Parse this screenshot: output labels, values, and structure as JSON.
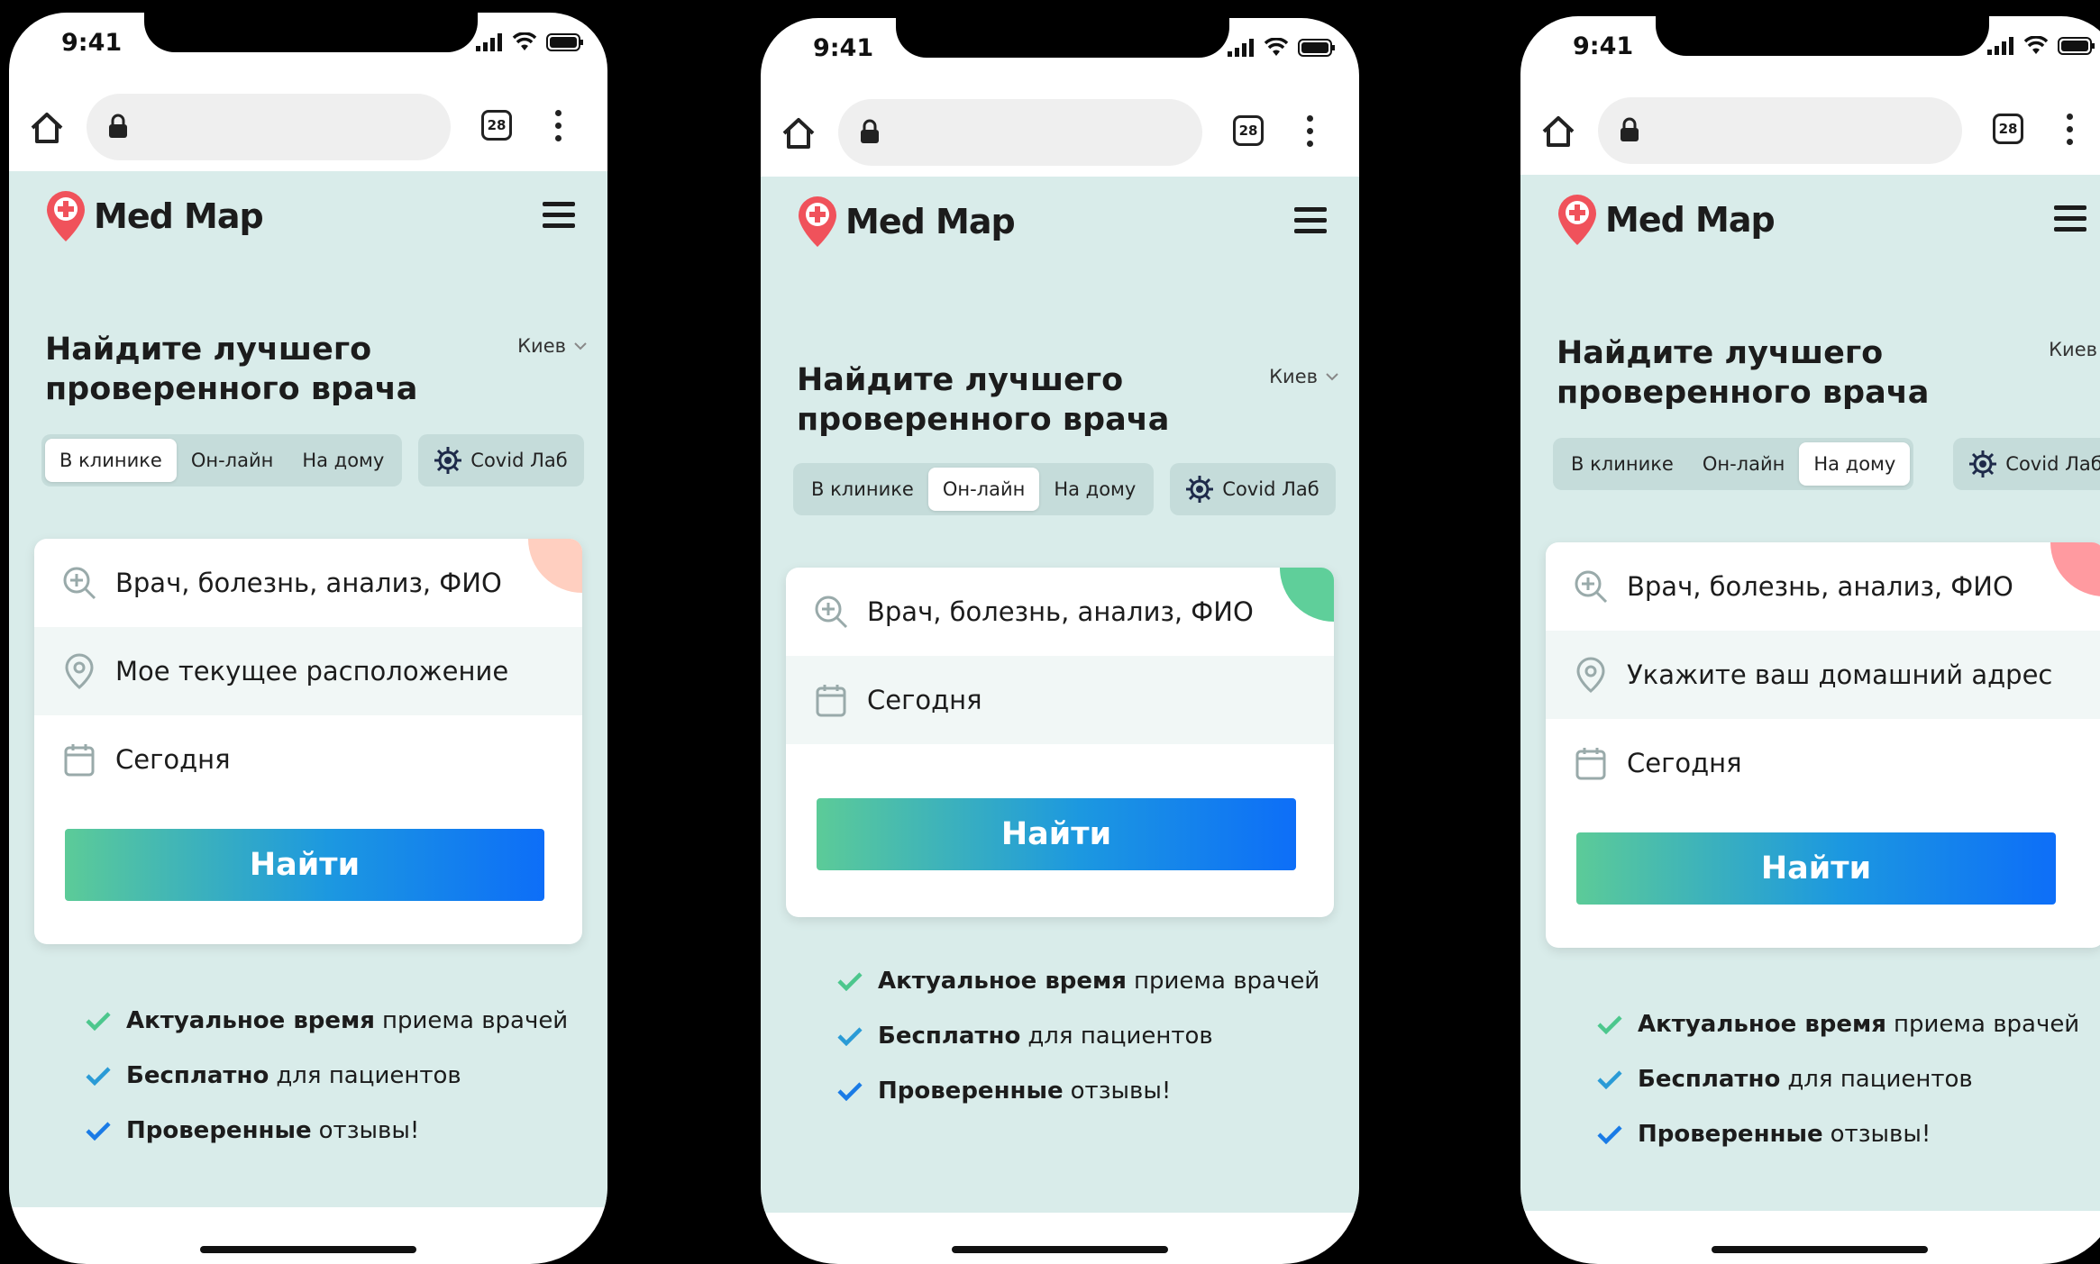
{
  "colors": {
    "bg_app": "#d9ecea",
    "accent_green": "#5ccb98",
    "accent_blue": "#0d6ef8",
    "logo_red": "#f0525b",
    "check_green": "#4cc78d",
    "check_blue": "#1a7be6"
  },
  "phones": [
    {
      "status": {
        "time": "9:41"
      },
      "browser": {
        "tab_count": "28"
      },
      "app": {
        "logo_text": "Med Map",
        "hero_title": "Найдите лучшего проверенного врача",
        "city": "Киев",
        "tabs": [
          "В клинике",
          "Он-лайн",
          "На дому"
        ],
        "active_tab": "В клинике",
        "covid_label": "Covid Лаб",
        "search_placeholder": "Врач, болезнь, анализ, ФИО",
        "location_placeholder": "Мое текущее расположение",
        "date_value": "Сегодня",
        "find_button": "Найти",
        "benefits": [
          {
            "bold": "Актуальное время",
            "rest": "приема врачей"
          },
          {
            "bold": "Бесплатно",
            "rest": "для пациентов"
          },
          {
            "bold": "Проверенные",
            "rest": "отзывы!"
          }
        ],
        "corner_color": "#ffcfc0"
      }
    },
    {
      "status": {
        "time": "9:41"
      },
      "browser": {
        "tab_count": "28"
      },
      "app": {
        "logo_text": "Med Map",
        "hero_title": "Найдите лучшего проверенного врача",
        "city": "Киев",
        "tabs": [
          "В клинике",
          "Он-лайн",
          "На дому"
        ],
        "active_tab": "Он-лайн",
        "covid_label": "Covid Лаб",
        "search_placeholder": "Врач, болезнь, анализ, ФИО",
        "date_value": "Сегодня",
        "find_button": "Найти",
        "benefits": [
          {
            "bold": "Актуальное время",
            "rest": "приема врачей"
          },
          {
            "bold": "Бесплатно",
            "rest": "для пациентов"
          },
          {
            "bold": "Проверенные",
            "rest": "отзывы!"
          }
        ],
        "corner_color": "#5fcf9a"
      }
    },
    {
      "status": {
        "time": "9:41"
      },
      "browser": {
        "tab_count": "28"
      },
      "app": {
        "logo_text": "Med Map",
        "hero_title": "Найдите лучшего проверенного врача",
        "city": "Киев",
        "tabs": [
          "В клинике",
          "Он-лайн",
          "На дому"
        ],
        "active_tab": "На дому",
        "covid_label": "Covid Лаб",
        "search_placeholder": "Врач, болезнь, анализ, ФИО",
        "location_placeholder": "Укажите ваш домашний адрес",
        "date_value": "Сегодня",
        "find_button": "Найти",
        "benefits": [
          {
            "bold": "Актуальное время",
            "rest": "приема врачей"
          },
          {
            "bold": "Бесплатно",
            "rest": "для пациентов"
          },
          {
            "bold": "Проверенные",
            "rest": "отзывы!"
          }
        ],
        "corner_color": "#ff9aa0"
      }
    }
  ]
}
